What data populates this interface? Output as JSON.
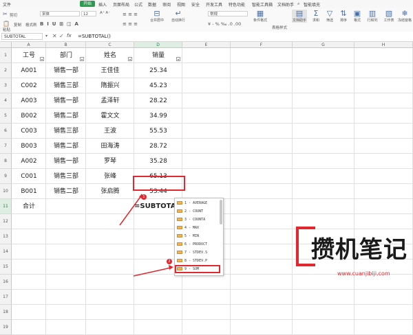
{
  "menubar": {
    "items": [
      "文件",
      "开始",
      "插入",
      "页面布局",
      "公式",
      "数据",
      "审阅",
      "视图",
      "安全",
      "开发工具",
      "特色功能",
      "智能工具箱",
      "文档助手"
    ],
    "search_placeholder": "智能填充"
  },
  "ribbon": {
    "clipboard": {
      "cut": "剪切",
      "paste": "粘贴",
      "copy": "复制",
      "format_painter": "格式刷"
    },
    "font_name": "宋体",
    "font_size": "12",
    "number_format": "常规",
    "merge": "合并居中",
    "wrap": "自动换行",
    "conditional_format": "条件格式",
    "table_style": "表格样式",
    "doc_helper": "文档助手",
    "sum": "求和",
    "filter": "筛选",
    "sort": "排序",
    "format": "格式",
    "row_col": "行和列",
    "worksheet": "工作表",
    "freeze": "冻结窗格"
  },
  "formula_bar": {
    "name_box": "SUBTOTAL",
    "formula": "=SUBTOTAL()"
  },
  "sheet": {
    "columns": [
      "A",
      "B",
      "C",
      "D",
      "E",
      "F",
      "G",
      "H"
    ],
    "row_numbers": [
      "1",
      "2",
      "3",
      "4",
      "5",
      "6",
      "7",
      "8",
      "9",
      "10",
      "11",
      "12",
      "13",
      "14",
      "15",
      "16",
      "17",
      "18",
      "19"
    ],
    "headers": [
      "工号",
      "部门",
      "姓名",
      "销量"
    ],
    "rows": [
      [
        "A001",
        "销售一部",
        "王佳佳",
        "25.34"
      ],
      [
        "C002",
        "销售三部",
        "隋振兴",
        "45.23"
      ],
      [
        "A003",
        "销售一部",
        "孟泽轩",
        "28.22"
      ],
      [
        "B002",
        "销售二部",
        "霍文文",
        "34.99"
      ],
      [
        "C003",
        "销售三部",
        "王波",
        "55.53"
      ],
      [
        "B003",
        "销售二部",
        "田海涛",
        "28.72"
      ],
      [
        "A002",
        "销售一部",
        "罗琴",
        "35.28"
      ],
      [
        "C001",
        "销售三部",
        "张峰",
        "65.13"
      ],
      [
        "B001",
        "销售二部",
        "张启腾",
        "53.44"
      ]
    ],
    "total_label": "合计",
    "active_cell_text": "=SUBTOTAL()"
  },
  "badges": [
    "1",
    "2"
  ],
  "dropdown": {
    "items": [
      "1 - AVERAGE",
      "2 - COUNT",
      "3 - COUNTA",
      "4 - MAX",
      "5 - MIN",
      "6 - PRODUCT",
      "7 - STDEV.S",
      "8 - STDEV.P",
      "9 - SUM"
    ]
  },
  "watermark": {
    "text": "攒机笔记",
    "url": "www.cuanjibiji.com"
  },
  "colors": {
    "accent_green": "#2c9a4f",
    "highlight_red": "#e0282e"
  }
}
